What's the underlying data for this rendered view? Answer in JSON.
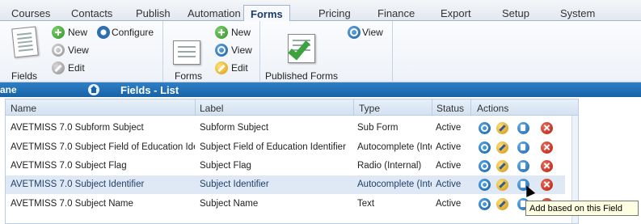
{
  "tabs": [
    {
      "label": "Courses"
    },
    {
      "label": "Contacts"
    },
    {
      "label": "Publish"
    },
    {
      "label": "Automation"
    },
    {
      "label": "Forms",
      "active": true
    },
    {
      "label": "Pricing"
    },
    {
      "label": "Finance"
    },
    {
      "label": "Export"
    },
    {
      "label": "Setup"
    },
    {
      "label": "System"
    }
  ],
  "ribbon": {
    "fields": {
      "label": "Fields",
      "new": "New",
      "configure": "Configure",
      "view": "View",
      "edit": "Edit"
    },
    "forms": {
      "label": "Forms",
      "new": "New",
      "view": "View",
      "edit": "Edit"
    },
    "published": {
      "label": "Published Forms",
      "view": "View"
    }
  },
  "panel": {
    "left_label": "ane",
    "title": "Fields - List"
  },
  "grid": {
    "columns": [
      "Name",
      "Label",
      "Type",
      "Status",
      "Actions"
    ],
    "rows": [
      {
        "name": "AVETMISS 7.0 Subform Subject",
        "label": "Subform Subject",
        "type": "Sub Form",
        "status": "Active"
      },
      {
        "name": "AVETMISS 7.0 Subject Field of Education Iden",
        "label": "Subject Field of Education Identifier",
        "type": "Autocomplete (Inte",
        "status": "Active"
      },
      {
        "name": "AVETMISS 7.0 Subject Flag",
        "label": "Subject Flag",
        "type": "Radio (Internal)",
        "status": "Active"
      },
      {
        "name": "AVETMISS 7.0 Subject Identifier",
        "label": "Subject Identifier",
        "type": "Autocomplete (Inte",
        "status": "Active",
        "highlighted": true
      },
      {
        "name": "AVETMISS 7.0 Subject Name",
        "label": "Subject Name",
        "type": "Text",
        "status": "Active"
      }
    ]
  },
  "tooltip": "Add based on this Field",
  "icons": {
    "new": "add-circle-icon",
    "configure": "gear-icon",
    "view": "magnifier-icon",
    "edit": "pencil-icon",
    "actions": [
      "view-icon",
      "edit-icon",
      "copy-icon",
      "delete-icon"
    ]
  }
}
